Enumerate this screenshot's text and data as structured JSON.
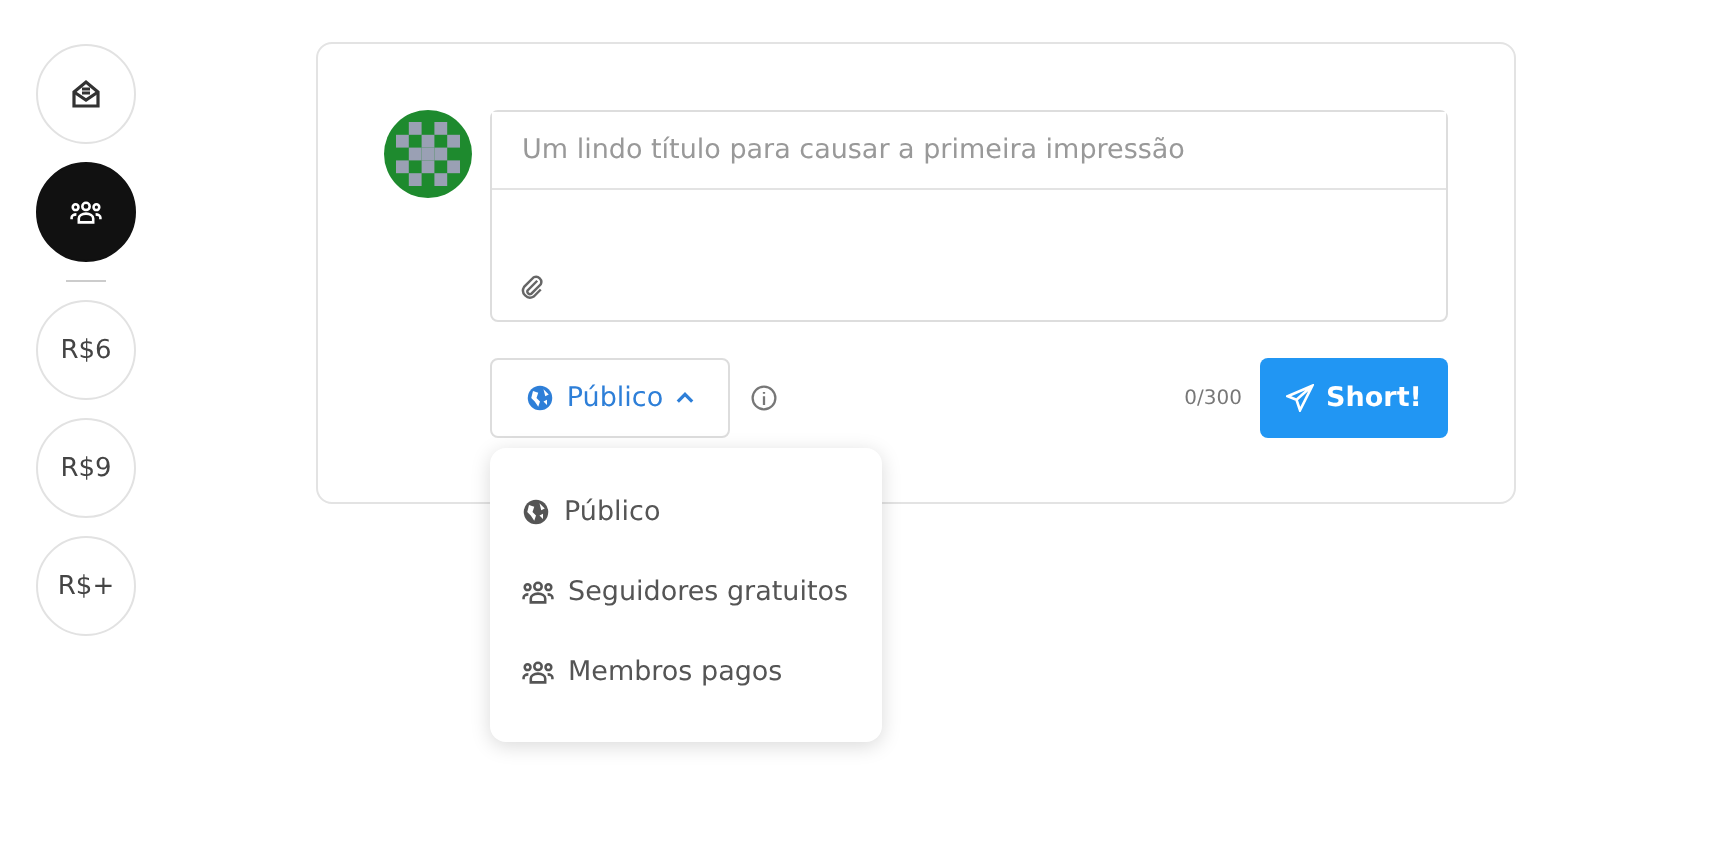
{
  "sidebar": {
    "items": [
      {
        "kind": "inbox",
        "selected": false
      },
      {
        "kind": "group",
        "selected": true
      },
      {
        "kind": "text",
        "label": "R$6",
        "selected": false
      },
      {
        "kind": "text",
        "label": "R$9",
        "selected": false
      },
      {
        "kind": "text",
        "label": "R$+",
        "selected": false
      }
    ]
  },
  "composer": {
    "title_placeholder": "Um lindo título para causar a primeira impressão",
    "visibility": {
      "label": "Público",
      "expanded": true
    },
    "counter": "0/300",
    "submit": "Short!"
  },
  "visibility_menu": [
    {
      "kind": "globe",
      "label": "Público"
    },
    {
      "kind": "group",
      "label": "Seguidores gratuitos"
    },
    {
      "kind": "group",
      "label": "Membros pagos"
    }
  ]
}
